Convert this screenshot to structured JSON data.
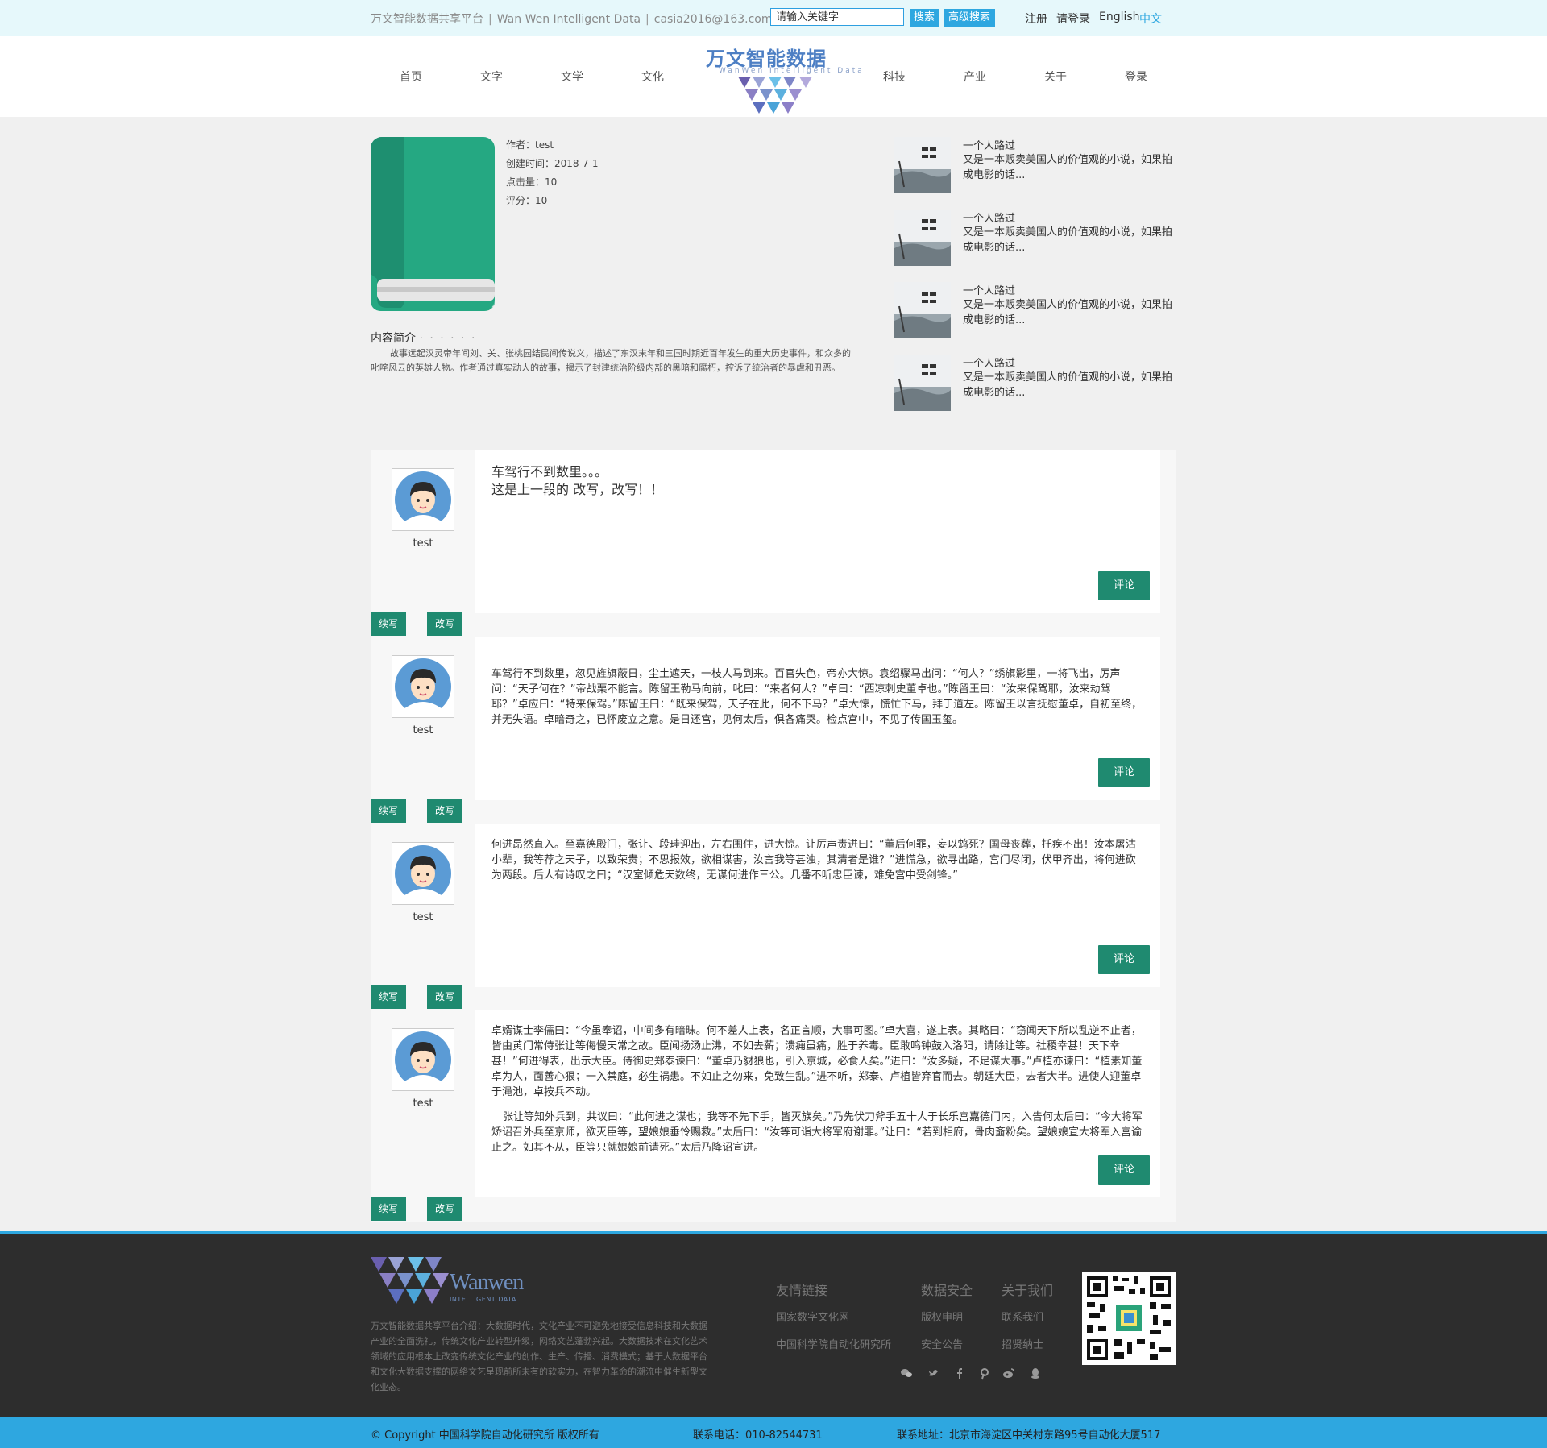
{
  "topbar": {
    "platform_cn": "万文智能数据共享平台",
    "platform_en": "Wan Wen Intelligent Data",
    "email": "casia2016@163.com",
    "search_placeholder": "请输入关键字",
    "search_label": "搜索",
    "advanced_label": "高级搜索",
    "register": "注册",
    "login_prompt": "请登录",
    "lang_en": "English",
    "lang_cn": "中文",
    "accent_color": "#2ea7e0"
  },
  "nav": {
    "items": [
      "首页",
      "文字",
      "文学",
      "文化",
      "科技",
      "产业",
      "关于",
      "登录"
    ],
    "logo_title": "万文智能数据",
    "logo_sub": "WanWen Intelligent Data"
  },
  "book": {
    "author_label": "作者：test",
    "created_label": "创建时间：2018-7-1",
    "clicks_label": "点击量：10",
    "score_label": "评分：10",
    "intro_title": "内容简介",
    "intro_dots": "· · · · · ·",
    "intro_text": "故事远起汉灵帝年间刘、关、张桃园结民间传说义，描述了东汉末年和三国时期近百年发生的重大历史事件，和众多的叱咤风云的英雄人物。作者通过真实动人的故事，揭示了封建统治阶级内部的黑暗和腐朽，控诉了统治者的暴虐和丑恶。"
  },
  "related": [
    {
      "title": "一个人路过",
      "desc": "又是一本贩卖美国人的价值观的小说，如果拍成电影的话..."
    },
    {
      "title": "一个人路过",
      "desc": "又是一本贩卖美国人的价值观的小说，如果拍成电影的话..."
    },
    {
      "title": "一个人路过",
      "desc": "又是一本贩卖美国人的价值观的小说，如果拍成电影的话..."
    },
    {
      "title": "一个人路过",
      "desc": "又是一本贩卖美国人的价值观的小说，如果拍成电影的话..."
    }
  ],
  "comments": [
    {
      "user": "test",
      "p1": "车驾行不到数里。。。",
      "p2": "这是上一段的 改写，改写！！",
      "comment_btn": "评论",
      "continue_btn": "续写",
      "rewrite_btn": "改写"
    },
    {
      "user": "test",
      "p1": "车驾行不到数里，忽见旌旗蔽日，尘土遮天，一枝人马到来。百官失色，帝亦大惊。袁绍骤马出问：“何人？”绣旗影里，一将飞出，厉声问：“天子何在？”帝战栗不能言。陈留王勒马向前，叱曰：“来者何人？”卓曰：“西凉刺史董卓也。”陈留王曰：“汝来保驾耶，汝来劫驾耶？”卓应曰：“特来保驾。”陈留王曰：“既来保驾，天子在此，何不下马？”卓大惊，慌忙下马，拜于道左。陈留王以言抚慰董卓，自初至终，并无失语。卓暗奇之，已怀废立之意。是日还宫，见何太后，俱各痛哭。检点宫中，不见了传国玉玺。",
      "comment_btn": "评论",
      "continue_btn": "续写",
      "rewrite_btn": "改写"
    },
    {
      "user": "test",
      "p1": "何进昂然直入。至嘉德殿门，张让、段珪迎出，左右围住，进大惊。让厉声责进曰：“董后何罪，妄以鸩死？国母丧葬，托疾不出！汝本屠沽小辈，我等荐之天子，以致荣贵；不思报效，欲相谋害，汝言我等甚浊，其清者是谁？”进慌急，欲寻出路，宫门尽闭，伏甲齐出，将何进砍为两段。后人有诗叹之曰；“汉室倾危天数终，无谋何进作三公。几番不听忠臣谏，难免宫中受剑锋。”",
      "comment_btn": "评论",
      "continue_btn": "续写",
      "rewrite_btn": "改写"
    },
    {
      "user": "test",
      "p1": "卓婿谋士李儒曰：“今虽奉诏，中间多有暗昧。何不差人上表，名正言顺，大事可图。”卓大喜，遂上表。其略曰：“窃闻天下所以乱逆不止者，皆由黄门常侍张让等侮慢天常之故。臣闻扬汤止沸，不如去薪；溃痈虽痛，胜于养毒。臣敢鸣钟鼓入洛阳，请除让等。社稷幸甚！天下幸甚！”何进得表，出示大臣。侍御史郑泰谏曰：“董卓乃豺狼也，引入京城，必食人矣。”进曰：“汝多疑，不足谋大事。”卢植亦谏曰：“植素知董卓为人，面善心狠；一入禁庭，必生祸患。不如止之勿来，免致生乱。”进不听，郑泰、卢植皆弃官而去。朝廷大臣，去者大半。进使人迎董卓于渑池，卓按兵不动。",
      "p2": "张让等知外兵到，共议曰：“此何进之谋也；我等不先下手，皆灭族矣。”乃先伏刀斧手五十人于长乐宫嘉德门内，入告何太后曰：“今大将军矫诏召外兵至京师，欲灭臣等，望娘娘垂怜赐救。”太后曰：“汝等可诣大将军府谢罪。”让曰：“若到相府，骨肉齑粉矣。望娘娘宣大将军入宫谕止之。如其不从，臣等只就娘娘前请死。”太后乃降诏宣进。",
      "comment_btn": "评论",
      "continue_btn": "续写",
      "rewrite_btn": "改写"
    }
  ],
  "footer": {
    "brand": "Wanwen",
    "brand_sub": "INTELLIGENT DATA",
    "intro": "万文智能数据共享平台介绍：大数据时代，文化产业不可避免地接受信息科技和大数据产业的全面洗礼，传统文化产业转型升级，网络文艺蓬勃兴起。大数据技术在文化艺术领域的应用根本上改变传统文化产业的创作、生产、传播、消费模式；基于大数据平台和文化大数据支撑的网络文艺呈现前所未有的软实力，在智力革命的潮流中催生新型文化业态。",
    "col1_title": "友情链接",
    "col1_links": [
      "国家数字文化网",
      "中国科学院自动化研究所"
    ],
    "col2_title": "数据安全",
    "col2_links": [
      "版权申明",
      "安全公告"
    ],
    "col3_title": "关于我们",
    "col3_links": [
      "联系我们",
      "招贤纳士"
    ],
    "social_icons": [
      "wechat-icon",
      "twitter-icon",
      "facebook-icon",
      "pinterest-icon",
      "weibo-icon",
      "qq-icon"
    ],
    "copyright": "© Copyright 中国科学院自动化研究所 版权所有",
    "phone": "联系电话：010-82544731",
    "address": "联系地址：北京市海淀区中关村东路95号自动化大厦517"
  }
}
